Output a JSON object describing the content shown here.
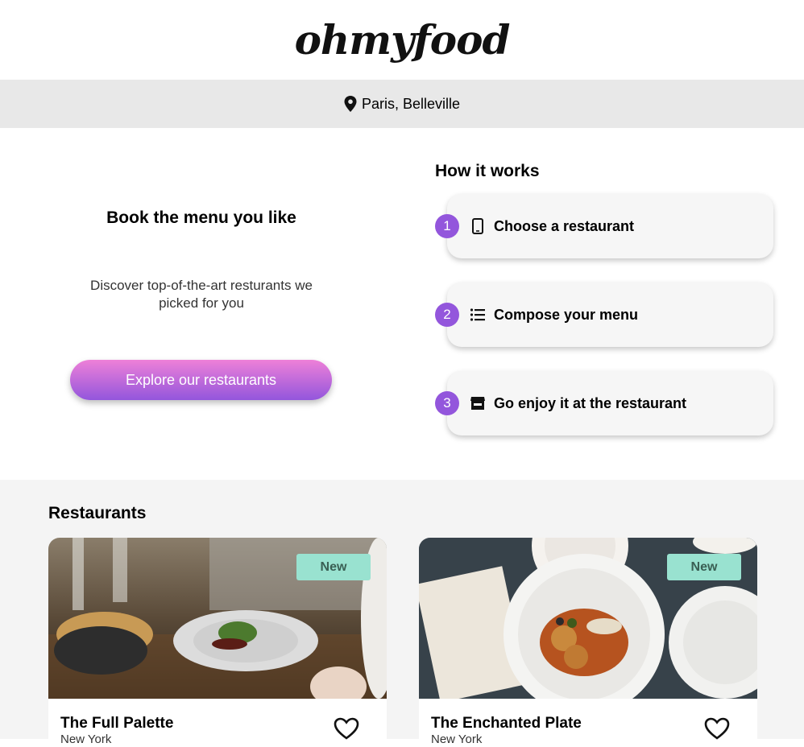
{
  "header": {
    "logo": "ohmyfood"
  },
  "location": {
    "text": "Paris, Belleville",
    "icon": "map-pin-icon"
  },
  "hero": {
    "title": "Book the menu you like",
    "subtitle": "Discover top-of-the-art resturants we picked for you",
    "cta_label": "Explore our restaurants"
  },
  "how": {
    "title": "How it works",
    "steps": [
      {
        "number": "1",
        "label": "Choose a restaurant",
        "icon": "mobile-phone-icon"
      },
      {
        "number": "2",
        "label": "Compose your menu",
        "icon": "list-icon"
      },
      {
        "number": "3",
        "label": "Go enjoy it at the restaurant",
        "icon": "store-icon"
      }
    ]
  },
  "restaurants": {
    "title": "Restaurants",
    "cards": [
      {
        "name": "The Full Palette",
        "city": "New York",
        "badge": "New"
      },
      {
        "name": "The Enchanted Plate",
        "city": "New York",
        "badge": "New"
      }
    ]
  },
  "colors": {
    "accent_purple": "#9356dc",
    "accent_pink": "#ee80d8",
    "badge_mint": "#99e2d0"
  }
}
